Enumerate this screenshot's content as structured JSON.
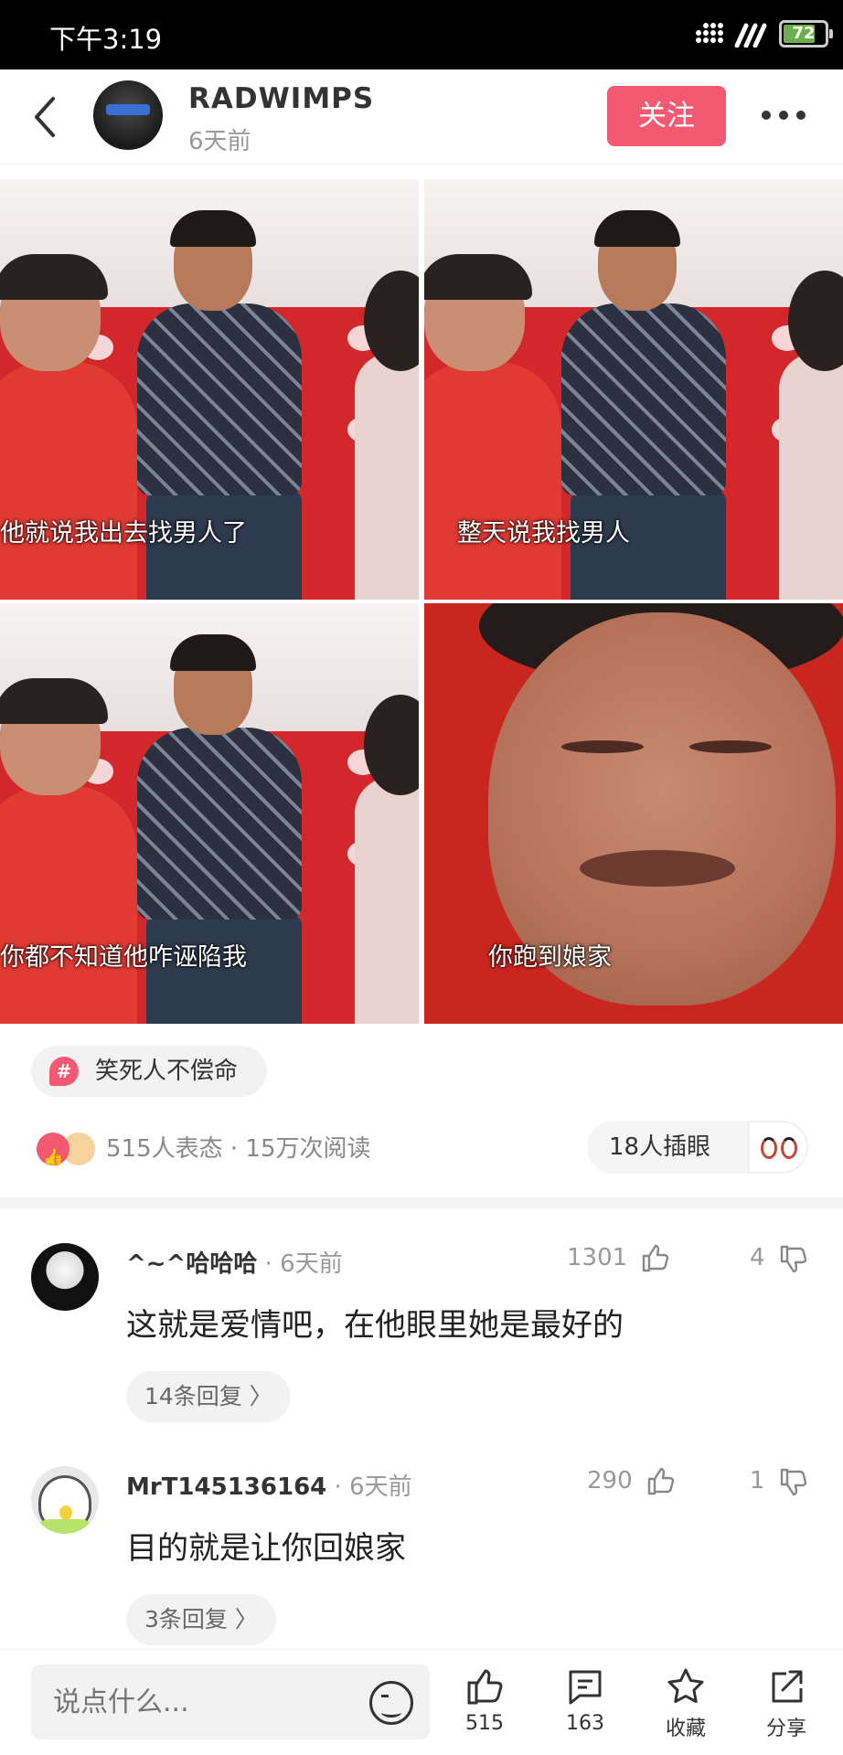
{
  "status_bar": {
    "time": "下午3:19",
    "battery": "72"
  },
  "header": {
    "username": "RADWIMPS",
    "post_time": "6天前",
    "follow_label": "关注"
  },
  "images": [
    {
      "subtitle": "他就说我出去找男人了"
    },
    {
      "subtitle": "整天说我找男人"
    },
    {
      "subtitle": "你都不知道他咋诬陷我"
    },
    {
      "subtitle": "你跑到娘家"
    }
  ],
  "topic": {
    "label": "笑死人不偿命"
  },
  "stats": {
    "text": "515人表态 · 15万次阅读",
    "plug_label": "18人插眼"
  },
  "comments": [
    {
      "name": "^~^哈哈哈",
      "time": "6天前",
      "text": "这就是爱情吧，在他眼里她是最好的",
      "likes": "1301",
      "dislikes": "4",
      "replies": "14条回复 〉"
    },
    {
      "name": "MrT145136164",
      "time": "6天前",
      "text": "目的就是让你回娘家",
      "likes": "290",
      "dislikes": "1",
      "replies": "3条回复 〉"
    }
  ],
  "bottom_bar": {
    "input_placeholder": "说点什么...",
    "like_count": "515",
    "comment_count": "163",
    "collect_label": "收藏",
    "share_label": "分享"
  },
  "colors": {
    "accent": "#f35a72",
    "sofa": "#d3282b"
  }
}
